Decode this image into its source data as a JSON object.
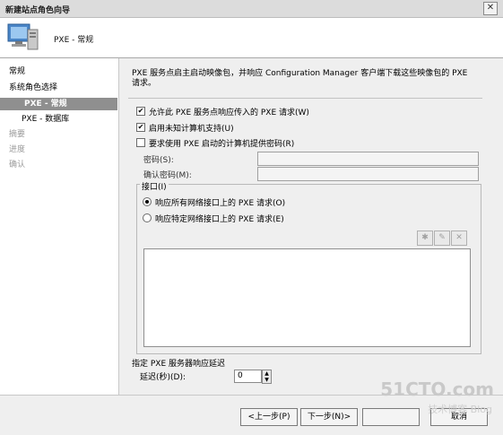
{
  "window": {
    "title": "新建站点角色向导",
    "close": "✕"
  },
  "header": {
    "title": "PXE - 常规"
  },
  "nav": {
    "items": [
      {
        "label": "常规",
        "state": "normal"
      },
      {
        "label": "系统角色选择",
        "state": "normal"
      },
      {
        "label": "PXE - 常规",
        "state": "active"
      },
      {
        "label": "PXE - 数据库",
        "state": "normal"
      },
      {
        "label": "摘要",
        "state": "disabled"
      },
      {
        "label": "进度",
        "state": "disabled"
      },
      {
        "label": "确认",
        "state": "disabled"
      }
    ]
  },
  "main": {
    "description_line1": "PXE 服务点启主启动映像包，并响应 Configuration Manager 客户端下载这些映像包的 PXE",
    "description_line2": "请求。",
    "allow_pxe": {
      "label": "允许此 PXE 服务点响应传入的 PXE 请求(W)",
      "checked": true
    },
    "unknown_computer": {
      "label": "启用未知计算机支持(U)",
      "checked": true
    },
    "require_password": {
      "label": "要求使用 PXE 启动的计算机提供密码(R)",
      "checked": false
    },
    "password_label": "密码(S):",
    "confirm_password_label": "确认密码(M):",
    "interfaces": {
      "group_label": "接口(I)",
      "all_interfaces": {
        "label": "响应所有网络接口上的 PXE 请求(O)",
        "selected": true
      },
      "specific_interfaces": {
        "label": "响应特定网络接口上的 PXE 请求(E)",
        "selected": false
      },
      "toolbar_icons": [
        "star-icon",
        "edit-icon",
        "delete-icon"
      ]
    },
    "delay_section_label": "指定 PXE 服务器响应延迟",
    "delay_label": "延迟(秒)(D):",
    "delay_value": "0"
  },
  "buttons": {
    "prev": "<上一步(P)",
    "next": "下一步(N)>",
    "cancel": "取消"
  },
  "watermark": {
    "main": "51CTO.com",
    "sub": "技术博客 Blog"
  }
}
